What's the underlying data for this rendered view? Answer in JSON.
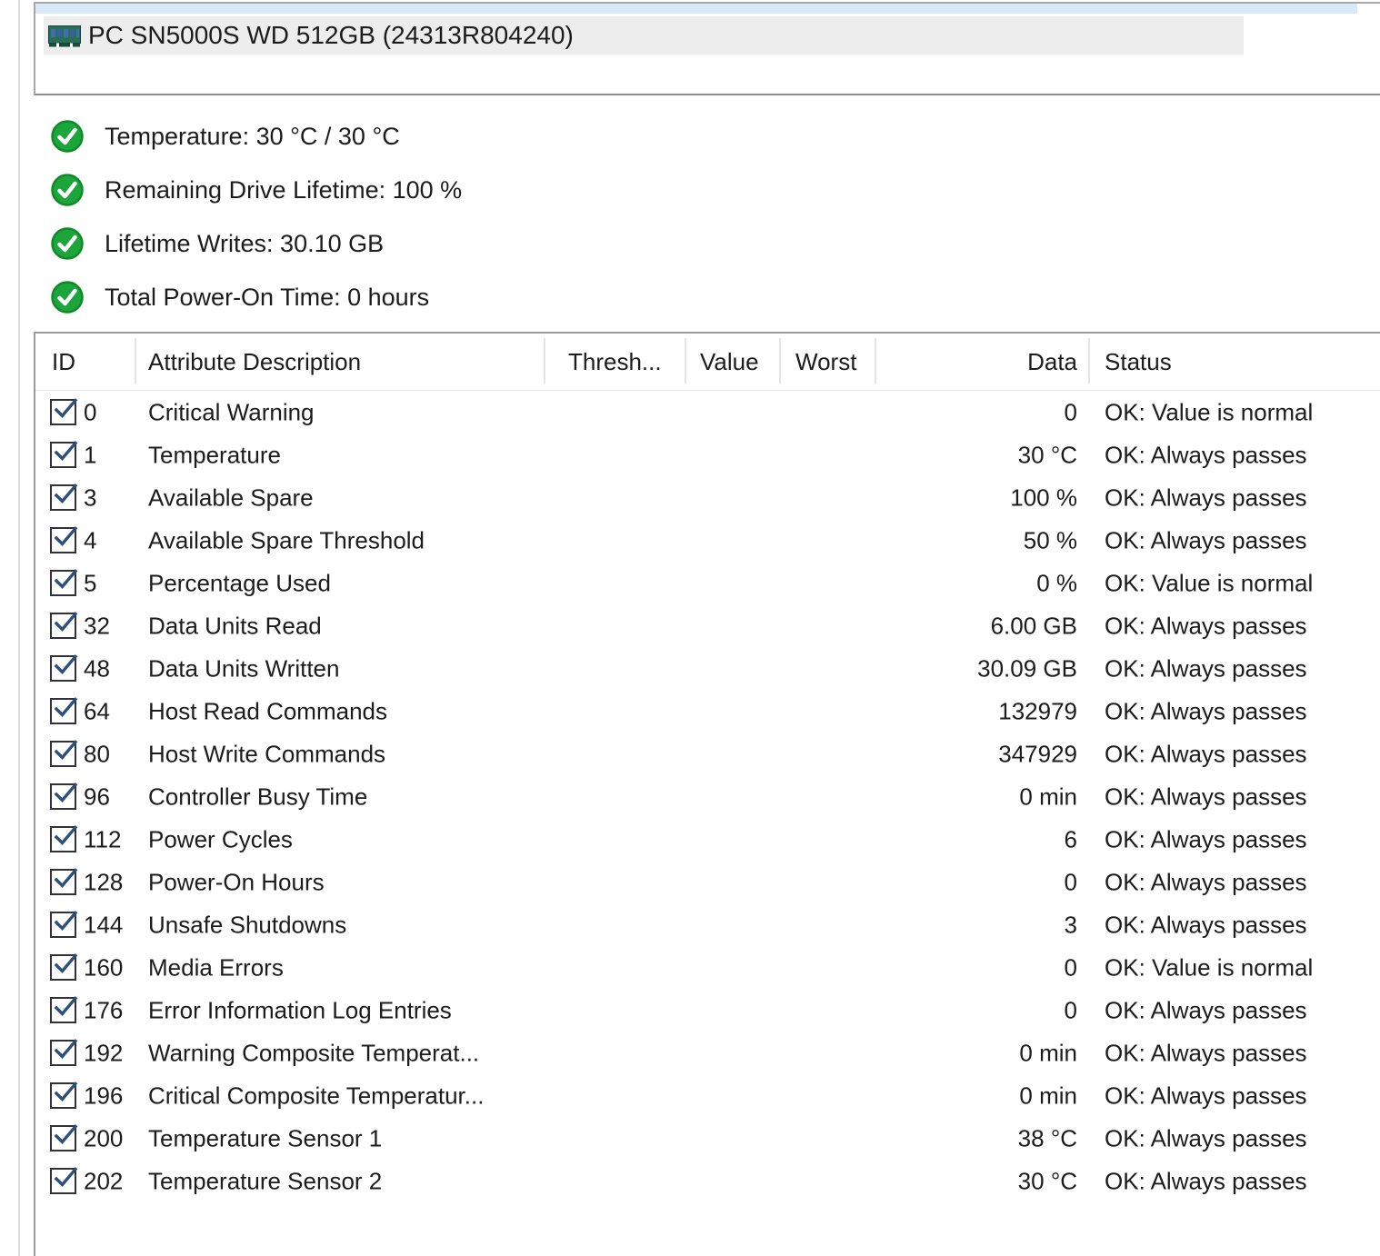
{
  "drive": {
    "label": "PC SN5000S WD 512GB (24313R804240)"
  },
  "health_summary": [
    {
      "label": "Temperature: 30 °C / 30 °C",
      "status": "ok"
    },
    {
      "label": "Remaining Drive Lifetime: 100 %",
      "status": "ok"
    },
    {
      "label": "Lifetime Writes: 30.10 GB",
      "status": "ok"
    },
    {
      "label": "Total Power-On Time: 0 hours",
      "status": "ok"
    }
  ],
  "table": {
    "columns": {
      "id": "ID",
      "description": "Attribute Description",
      "threshold": "Thresh...",
      "value": "Value",
      "worst": "Worst",
      "data": "Data",
      "status": "Status"
    },
    "rows": [
      {
        "checked": true,
        "id": "0",
        "description": "Critical Warning",
        "threshold": "",
        "value": "",
        "worst": "",
        "data": "0",
        "status": "OK: Value is normal"
      },
      {
        "checked": true,
        "id": "1",
        "description": "Temperature",
        "threshold": "",
        "value": "",
        "worst": "",
        "data": "30 °C",
        "status": "OK: Always passes"
      },
      {
        "checked": true,
        "id": "3",
        "description": "Available Spare",
        "threshold": "",
        "value": "",
        "worst": "",
        "data": "100 %",
        "status": "OK: Always passes"
      },
      {
        "checked": true,
        "id": "4",
        "description": "Available Spare Threshold",
        "threshold": "",
        "value": "",
        "worst": "",
        "data": "50 %",
        "status": "OK: Always passes"
      },
      {
        "checked": true,
        "id": "5",
        "description": "Percentage Used",
        "threshold": "",
        "value": "",
        "worst": "",
        "data": "0 %",
        "status": "OK: Value is normal"
      },
      {
        "checked": true,
        "id": "32",
        "description": "Data Units Read",
        "threshold": "",
        "value": "",
        "worst": "",
        "data": "6.00 GB",
        "status": "OK: Always passes"
      },
      {
        "checked": true,
        "id": "48",
        "description": "Data Units Written",
        "threshold": "",
        "value": "",
        "worst": "",
        "data": "30.09 GB",
        "status": "OK: Always passes"
      },
      {
        "checked": true,
        "id": "64",
        "description": "Host Read Commands",
        "threshold": "",
        "value": "",
        "worst": "",
        "data": "132979",
        "status": "OK: Always passes"
      },
      {
        "checked": true,
        "id": "80",
        "description": "Host Write Commands",
        "threshold": "",
        "value": "",
        "worst": "",
        "data": "347929",
        "status": "OK: Always passes"
      },
      {
        "checked": true,
        "id": "96",
        "description": "Controller Busy Time",
        "threshold": "",
        "value": "",
        "worst": "",
        "data": "0 min",
        "status": "OK: Always passes"
      },
      {
        "checked": true,
        "id": "112",
        "description": "Power Cycles",
        "threshold": "",
        "value": "",
        "worst": "",
        "data": "6",
        "status": "OK: Always passes"
      },
      {
        "checked": true,
        "id": "128",
        "description": "Power-On Hours",
        "threshold": "",
        "value": "",
        "worst": "",
        "data": "0",
        "status": "OK: Always passes"
      },
      {
        "checked": true,
        "id": "144",
        "description": "Unsafe Shutdowns",
        "threshold": "",
        "value": "",
        "worst": "",
        "data": "3",
        "status": "OK: Always passes"
      },
      {
        "checked": true,
        "id": "160",
        "description": "Media Errors",
        "threshold": "",
        "value": "",
        "worst": "",
        "data": "0",
        "status": "OK: Value is normal"
      },
      {
        "checked": true,
        "id": "176",
        "description": "Error Information Log Entries",
        "threshold": "",
        "value": "",
        "worst": "",
        "data": "0",
        "status": "OK: Always passes"
      },
      {
        "checked": true,
        "id": "192",
        "description": "Warning Composite Temperat...",
        "threshold": "",
        "value": "",
        "worst": "",
        "data": "0 min",
        "status": "OK: Always passes"
      },
      {
        "checked": true,
        "id": "196",
        "description": "Critical Composite Temperatur...",
        "threshold": "",
        "value": "",
        "worst": "",
        "data": "0 min",
        "status": "OK: Always passes"
      },
      {
        "checked": true,
        "id": "200",
        "description": "Temperature Sensor 1",
        "threshold": "",
        "value": "",
        "worst": "",
        "data": "38 °C",
        "status": "OK: Always passes"
      },
      {
        "checked": true,
        "id": "202",
        "description": "Temperature Sensor 2",
        "threshold": "",
        "value": "",
        "worst": "",
        "data": "30 °C",
        "status": "OK: Always passes"
      }
    ]
  },
  "colors": {
    "ok_green": "#1ca53b",
    "selected_row_gray": "#ededed",
    "list_top_strip_blue": "#d8e9f7",
    "checkbox_check_navy": "#2c4f7c"
  }
}
